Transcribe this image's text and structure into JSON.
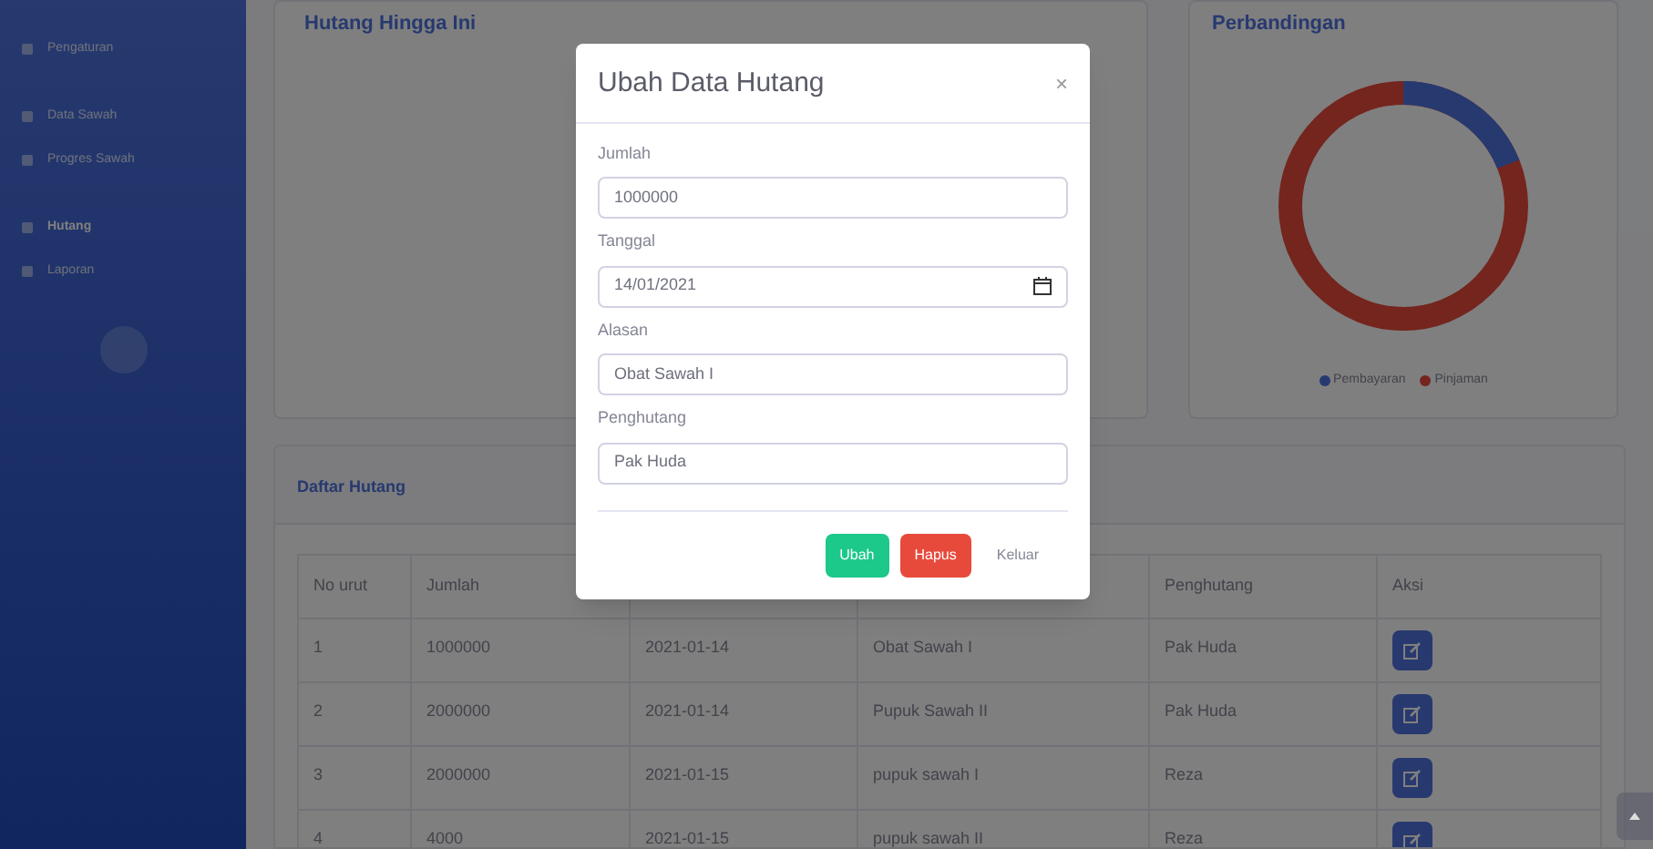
{
  "sidebar": {
    "items": [
      {
        "label": "Pengaturan",
        "selected": false
      },
      {
        "label": "Data Sawah",
        "selected": false
      },
      {
        "label": "Progres Sawah",
        "selected": false
      },
      {
        "label": "Hutang",
        "selected": true
      },
      {
        "label": "Laporan",
        "selected": false
      }
    ]
  },
  "cards": [
    {
      "title": "Hutang Hingga Ini"
    },
    {
      "title": "Perbandingan",
      "legend": [
        {
          "label": "Pembayaran",
          "color": "#273a70"
        },
        {
          "label": "Pinjaman",
          "color": "#74251e"
        }
      ]
    }
  ],
  "table": {
    "title": "Daftar Hutang",
    "columns": [
      "No urut",
      "Jumlah",
      "",
      "",
      "Penghutang",
      "Aksi"
    ],
    "rows": [
      [
        "1",
        "1000000",
        "2021-01-14",
        "Obat Sawah I",
        "Pak Huda"
      ],
      [
        "2",
        "2000000",
        "2021-01-14",
        "Pupuk Sawah II",
        "Pak Huda"
      ],
      [
        "3",
        "2000000",
        "2021-01-15",
        "pupuk sawah I",
        "Reza"
      ],
      [
        "4",
        "4000",
        "2021-01-15",
        "pupuk sawah II",
        "Reza"
      ]
    ]
  },
  "modal": {
    "title": "Ubah Data Hutang",
    "close": "×",
    "fields": [
      {
        "label": "Jumlah",
        "value": "1000000",
        "kind": "text"
      },
      {
        "label": "Tanggal",
        "value": "14/01/2021",
        "kind": "date"
      },
      {
        "label": "Alasan",
        "value": "Obat Sawah I",
        "kind": "text"
      },
      {
        "label": "Penghutang",
        "value": "Pak Huda",
        "kind": "text"
      }
    ],
    "buttons": [
      {
        "label": "Ubah",
        "kind": "success"
      },
      {
        "label": "Hapus",
        "kind": "danger"
      },
      {
        "label": "Keluar",
        "kind": "link"
      }
    ]
  }
}
